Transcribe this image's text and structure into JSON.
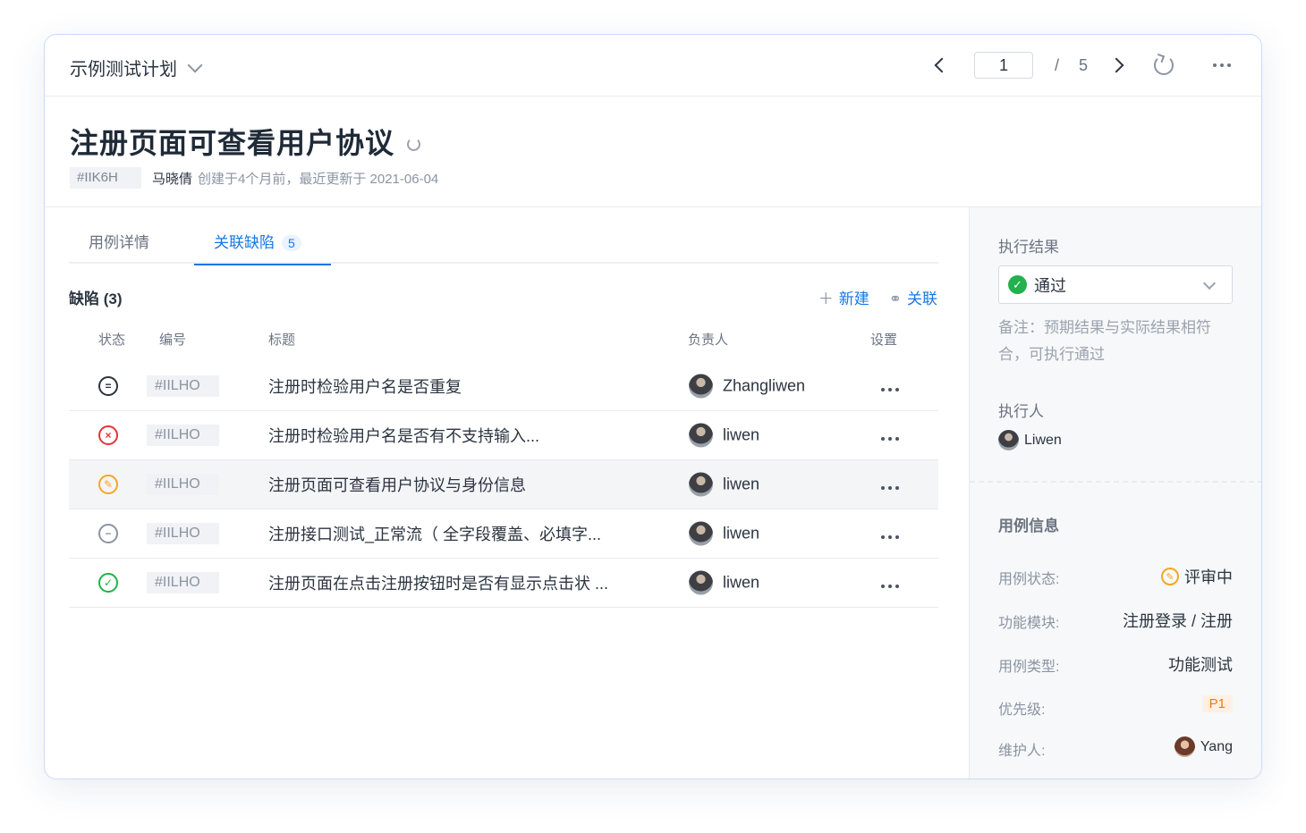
{
  "topbar": {
    "plan_name": "示例测试计划",
    "current_page": "1",
    "page_separator": "/",
    "total_pages": "5"
  },
  "case": {
    "title": "注册页面可查看用户协议",
    "code": "#IIK6H",
    "author": "马晓倩",
    "meta_info": "创建于4个月前，最近更新于 2021-06-04"
  },
  "tabs": [
    {
      "label": "用例详情"
    },
    {
      "label": "关联缺陷",
      "badge": "5"
    }
  ],
  "defects": {
    "section_title": "缺陷 (3)",
    "new_label": "新建",
    "link_label": "关联",
    "columns": [
      "状态",
      "编号",
      "标题",
      "负责人",
      "设置"
    ],
    "rows": [
      {
        "status": "pending",
        "code": "#IILHO",
        "title": "注册时检验用户名是否重复",
        "owner": "Zhangliwen"
      },
      {
        "status": "fail",
        "code": "#IILHO",
        "title": "注册时检验用户名是否有不支持输入...",
        "owner": "liwen"
      },
      {
        "status": "review",
        "code": "#IILHO",
        "title": "注册页面可查看用户协议与身份信息",
        "owner": "liwen"
      },
      {
        "status": "skip",
        "code": "#IILHO",
        "title": "注册接口测试_正常流（ 全字段覆盖、必填字...",
        "owner": "liwen"
      },
      {
        "status": "pass",
        "code": "#IILHO",
        "title": "注册页面在点击注册按钮时是否有显示点击状 ...",
        "owner": "liwen"
      }
    ]
  },
  "side": {
    "result_label": "执行结果",
    "result_value": "通过",
    "note": "备注：预期结果与实际结果相符合，可执行通过",
    "executor_label": "执行人",
    "executor_name": "Liwen",
    "info_title": "用例信息",
    "info": {
      "status_key": "用例状态:",
      "status_value": "评审中",
      "module_key": "功能模块:",
      "module_value": "注册登录 / 注册",
      "type_key": "用例类型:",
      "type_value": "功能测试",
      "priority_key": "优先级:",
      "priority_value": "P1",
      "maintainer_key": "维护人:",
      "maintainer_value": "Yang"
    }
  },
  "colors": {
    "accent": "#1677e5",
    "pass": "#22b14c",
    "fail": "#e5333b",
    "review": "#f5a623"
  }
}
